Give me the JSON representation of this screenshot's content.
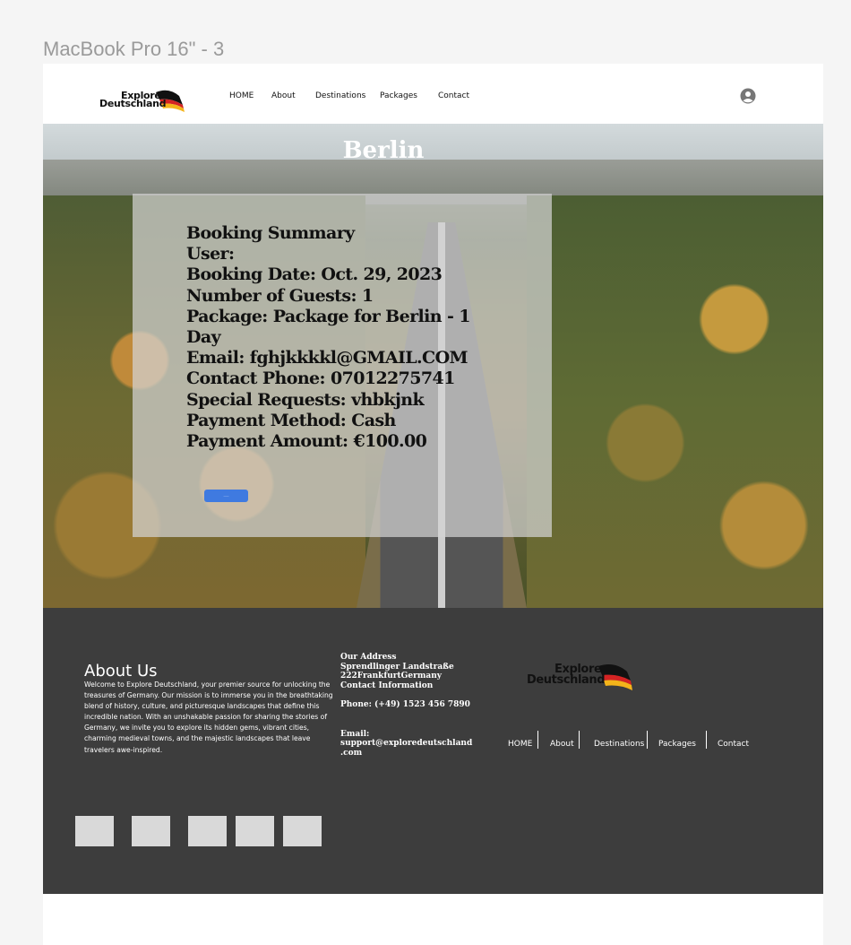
{
  "frame_label": "MacBook Pro 16\" - 3",
  "brand": {
    "line1": "Explore",
    "line2": "Deutschland"
  },
  "nav": [
    "HOME",
    "About",
    "Destinations",
    "Packages",
    "Contact"
  ],
  "hero": {
    "title": "Berlin"
  },
  "booking": {
    "lines": [
      "Booking Summary",
      "User:",
      "Booking Date: Oct. 29, 2023",
      "Number of Guests: 1",
      "Package: Package for Berlin - 1",
      "Day",
      "Email: fghjkkkkl@GMAIL.COM",
      "Contact Phone: 07012275741",
      "Special Requests: vhbkjnk",
      "Payment Method: Cash",
      "Payment Amount: €100.00"
    ],
    "button_label": "——"
  },
  "footer": {
    "about_title": "About Us",
    "about_text": "Welcome to Explore Deutschland, your premier source for unlocking the treasures of Germany. Our mission is to immerse you in the breathtaking blend of history, culture, and picturesque landscapes that define this incredible nation. With an unshakable passion for sharing the stories of Germany, we invite you to explore its hidden gems, vibrant cities, charming medieval towns, and the majestic landscapes that leave travelers awe-inspired.",
    "address_heading": "Our Address",
    "address_line1": "Sprendlinger Landstraße",
    "address_line2": "222FrankfurtGermany",
    "contact_heading": "Contact Information",
    "phone": "Phone: (+49) 1523 456 7890",
    "email_label": "Email:",
    "email_value": "support@exploredeutschland",
    "email_value2": ".com",
    "nav": [
      "HOME",
      "About",
      "Destinations",
      "Packages",
      "Contact"
    ]
  },
  "colors": {
    "footer_bg": "#3d3d3d",
    "button": "#3f7ae0",
    "card": "rgba(210,210,210,0.72)"
  },
  "icons": {
    "user": "user-circle-icon",
    "flag": "german-flag-icon"
  }
}
